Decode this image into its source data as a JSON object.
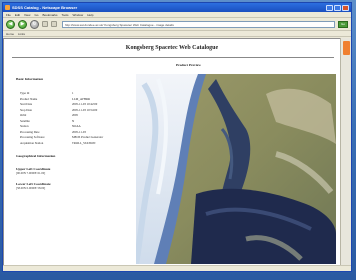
{
  "window": {
    "title": "SDSS Catalog - Netscape Browser"
  },
  "menu": [
    "File",
    "Edit",
    "View",
    "Go",
    "Bookmarks",
    "Tools",
    "Window",
    "Help"
  ],
  "toolbar": {
    "back": "◀",
    "forward": "▶",
    "reload": "↻",
    "address": "http://www.sat.dundee.ac.uk/ Kongsberg Spacetec Web Catalogue - image details",
    "go": "Go"
  },
  "links": [
    "Home",
    "Links"
  ],
  "page": {
    "title": "Kongsberg Spacetec Web Catalogue",
    "image_caption": "Product Preview",
    "basic_heading": "Basic Information",
    "info": [
      {
        "label": "Type Id",
        "value": "1"
      },
      {
        "label": "Product Name",
        "value": "LLM_AVHRR"
      },
      {
        "label": "Start Date",
        "value": "2005-11-03 10:42:00"
      },
      {
        "label": "Stop Date",
        "value": "2005-11-03 10:54:00"
      },
      {
        "label": "Orbit",
        "value": "2095"
      },
      {
        "label": "Satellite",
        "value": "N"
      },
      {
        "label": "Station",
        "value": "NOAA"
      },
      {
        "label": "Processing Date",
        "value": "2005-11-03"
      },
      {
        "label": "Processing Software",
        "value": "MEOS Product Generator"
      },
      {
        "label": "Acquisition Station",
        "value": "TROLL_STATION"
      }
    ],
    "geo_heading": "Geographical Information",
    "coords": [
      {
        "title": "Upper Left Coordinate",
        "value": "[90.00N 7.0000E 61.00]"
      },
      {
        "title": "Lower Left Coordinate",
        "value": "[58.00N 0.0000E 58.00]"
      }
    ]
  },
  "colors": {
    "accent": "#f08030",
    "titlebar": "#1a4fbf"
  }
}
